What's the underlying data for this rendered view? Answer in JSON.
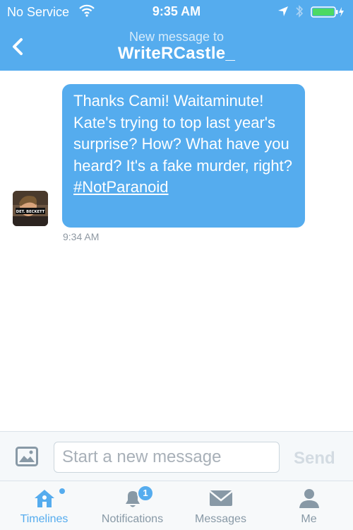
{
  "status_bar": {
    "carrier": "No Service",
    "time": "9:35 AM"
  },
  "header": {
    "subtitle": "New message to",
    "title": "WriteRCastle_"
  },
  "conversation": {
    "messages": [
      {
        "text": "Thanks Cami! Waitaminute! Kate's trying to top last year's surprise? How? What have you heard? It's a fake murder, right?",
        "hashtag": "#NotParanoid",
        "time": "9:34 AM",
        "avatar_caption": "DET. BECKETT"
      }
    ]
  },
  "composer": {
    "placeholder": "Start a new message",
    "value": "",
    "send_label": "Send"
  },
  "tabbar": {
    "items": [
      {
        "label": "Timelines",
        "icon": "home-icon",
        "active": true
      },
      {
        "label": "Notifications",
        "icon": "bell-icon",
        "badge": "1"
      },
      {
        "label": "Messages",
        "icon": "envelope-icon"
      },
      {
        "label": "Me",
        "icon": "person-icon"
      }
    ]
  },
  "colors": {
    "accent": "#55acee",
    "inactive": "#8899a6"
  }
}
